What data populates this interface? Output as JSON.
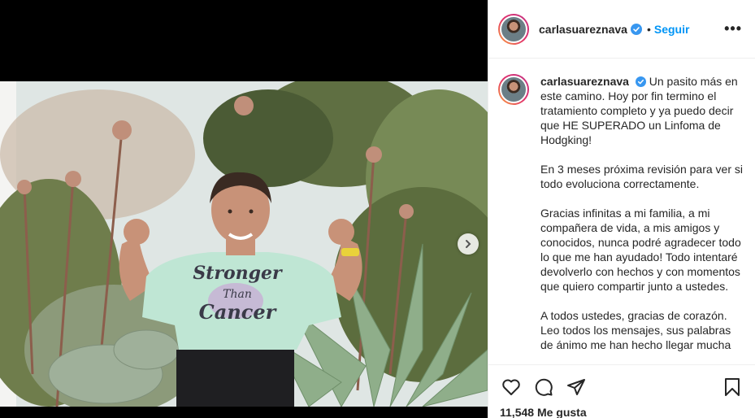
{
  "post": {
    "username": "carlasuareznava",
    "follow_label": "Seguir",
    "separator": "•",
    "more_label": "•••",
    "caption_first": "Un pasito más en este camino. Hoy por fin termino el tratamiento completo y ya puedo decir que HE SUPERADO un Linfoma de Hodgking!",
    "caption_paragraphs": [
      "En 3 meses próxima revisión para ver si todo evoluciona correctamente.",
      "Gracias infinitas a mi familia, a mi compañera de vida, a mis amigos y conocidos, nunca podré agradecer todo lo que me han ayudado! Todo intentaré devolverlo con hechos y con momentos que quiero compartir junto a ustedes.",
      "A todos ustedes, gracias de corazón. Leo todos los mensajes, sus palabras de ánimo me han hecho llegar mucha"
    ],
    "likes": "11,548 Me gusta",
    "shirt_text": [
      "Stronger",
      "Than",
      "Cancer"
    ]
  },
  "icons": {
    "like": "heart-icon",
    "comment": "comment-icon",
    "share": "share-icon",
    "save": "bookmark-icon",
    "next": "chevron-right-icon",
    "verified": "verified-badge-icon"
  },
  "colors": {
    "accent": "#0095f6",
    "verified": "#3897f0",
    "text": "#262626",
    "border": "#efefef"
  }
}
